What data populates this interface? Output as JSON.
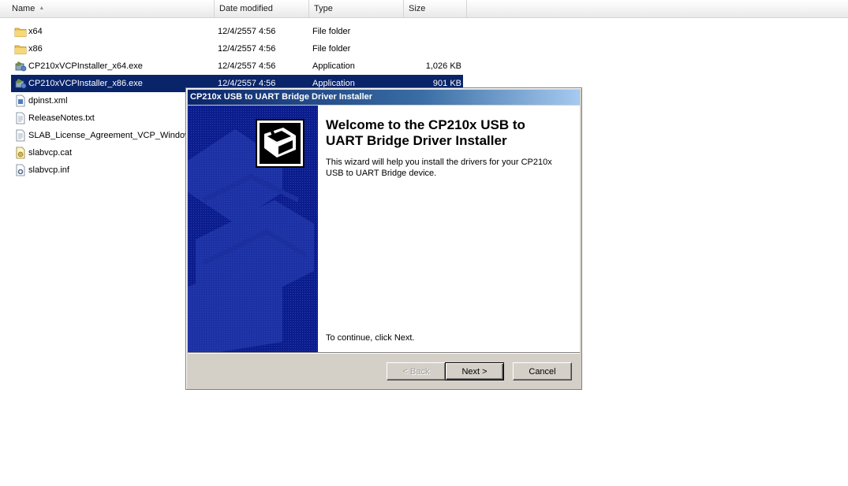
{
  "explorer": {
    "columns": {
      "name": "Name",
      "date": "Date modified",
      "type": "Type",
      "size": "Size"
    },
    "files": [
      {
        "name": "x64",
        "date": "12/4/2557 4:56",
        "type": "File folder",
        "size": "",
        "icon": "folder-icon"
      },
      {
        "name": "x86",
        "date": "12/4/2557 4:56",
        "type": "File folder",
        "size": "",
        "icon": "folder-icon"
      },
      {
        "name": "CP210xVCPInstaller_x64.exe",
        "date": "12/4/2557 4:56",
        "type": "Application",
        "size": "1,026 KB",
        "icon": "installer-icon"
      },
      {
        "name": "CP210xVCPInstaller_x86.exe",
        "date": "12/4/2557 4:56",
        "type": "Application",
        "size": "901 KB",
        "icon": "installer-icon",
        "selected": true
      },
      {
        "name": "dpinst.xml",
        "date": "",
        "type": "",
        "size": "",
        "icon": "xml-file-icon"
      },
      {
        "name": "ReleaseNotes.txt",
        "date": "",
        "type": "",
        "size": "",
        "icon": "text-file-icon"
      },
      {
        "name": "SLAB_License_Agreement_VCP_Windows",
        "date": "",
        "type": "",
        "size": "",
        "icon": "text-file-icon"
      },
      {
        "name": "slabvcp.cat",
        "date": "",
        "type": "",
        "size": "",
        "icon": "catalog-file-icon"
      },
      {
        "name": "slabvcp.inf",
        "date": "",
        "type": "",
        "size": "",
        "icon": "settings-file-icon"
      }
    ]
  },
  "dialog": {
    "title": "CP210x USB to UART Bridge Driver Installer",
    "welcome_title": "Welcome to the CP210x USB to UART Bridge Driver Installer",
    "description": "This wizard will help you install the drivers for your CP210x USB to UART Bridge device.",
    "continue_text": "To continue, click Next.",
    "buttons": {
      "back": "< Back",
      "next": "Next >",
      "cancel": "Cancel"
    }
  },
  "colors": {
    "selection": "#0a246a",
    "banner": "#0b1c8c",
    "dialog_face": "#d4d0c8"
  }
}
